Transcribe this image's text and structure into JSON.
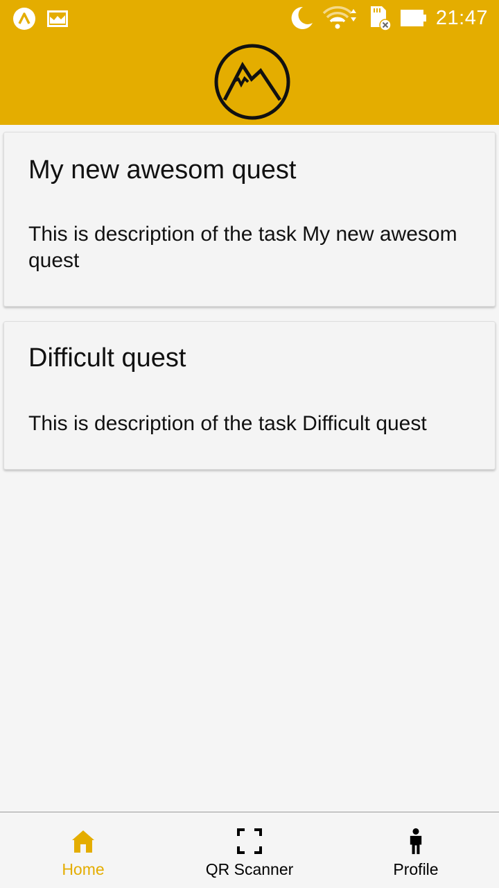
{
  "colors": {
    "accent": "#e4ad00",
    "background": "#f5f5f5",
    "card": "#f4f4f4",
    "text": "#111111"
  },
  "status_bar": {
    "time": "21:47",
    "left_icons": [
      "app-notification-icon",
      "image-notification-icon"
    ],
    "right_icons": [
      "moon-icon",
      "wifi-icon",
      "sd-card-icon",
      "battery-icon"
    ]
  },
  "header": {
    "logo": "mountain-logo-icon"
  },
  "quests": [
    {
      "title": "My new awesom quest",
      "description": "This is description of the task My new awesom quest"
    },
    {
      "title": "Difficult quest",
      "description": "This is description of the task Difficult quest"
    }
  ],
  "bottom_nav": {
    "items": [
      {
        "label": "Home",
        "icon": "home-icon",
        "active": true
      },
      {
        "label": "QR Scanner",
        "icon": "qr-scan-icon",
        "active": false
      },
      {
        "label": "Profile",
        "icon": "person-icon",
        "active": false
      }
    ]
  }
}
